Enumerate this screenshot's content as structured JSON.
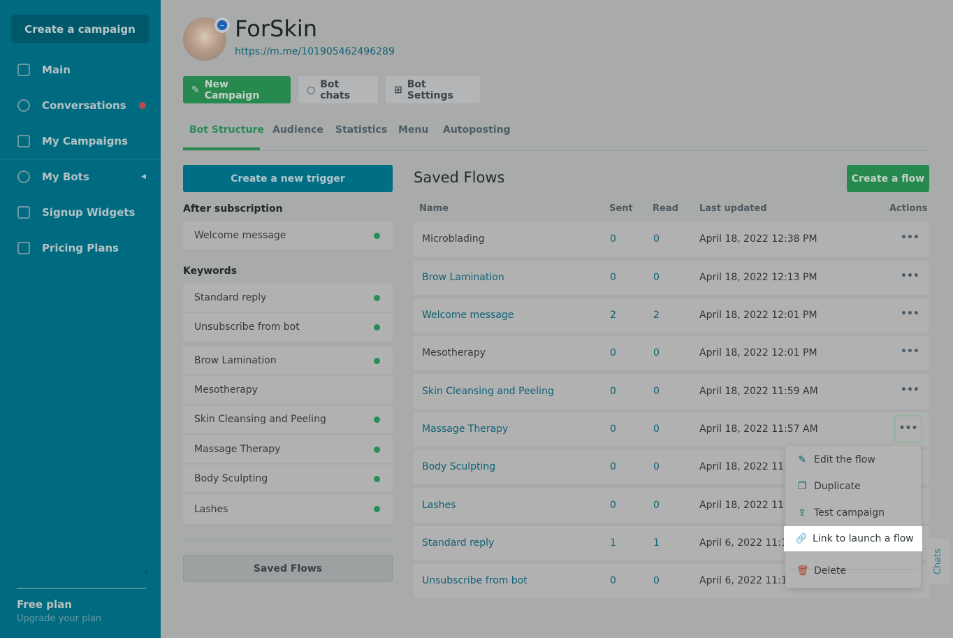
{
  "sidebar": {
    "create_label": "Create a campaign",
    "items": [
      {
        "label": "Main",
        "icon": "sliders-icon"
      },
      {
        "label": "Conversations",
        "icon": "chat-icon",
        "badge": "red-dot"
      },
      {
        "label": "My Campaigns",
        "icon": "upload-icon"
      },
      {
        "label": "My Bots",
        "icon": "globe-icon"
      },
      {
        "label": "Signup Widgets",
        "icon": "widget-icon"
      },
      {
        "label": "Pricing Plans",
        "icon": "wallet-icon"
      }
    ],
    "plan_title": "Free plan",
    "plan_sub": "Upgrade your plan"
  },
  "header": {
    "title": "ForSkin",
    "url": "https://m.me/101905462496289",
    "buttons": {
      "new_campaign": "New Campaign",
      "bot_chats": "Bot chats",
      "bot_settings": "Bot Settings"
    }
  },
  "tabs": [
    "Bot Structure",
    "Audience",
    "Statistics",
    "Menu",
    "Autoposting"
  ],
  "left": {
    "trigger_label": "Create a new trigger",
    "after_sub_label": "After subscription",
    "after_sub": [
      {
        "label": "Welcome message",
        "active": true
      }
    ],
    "keywords_label": "Keywords",
    "keywords": [
      {
        "label": "Standard reply",
        "active": true
      },
      {
        "label": "Unsubscribe from bot",
        "active": true
      }
    ],
    "flows": [
      {
        "label": "Brow Lamination",
        "active": true
      },
      {
        "label": "Mesotherapy",
        "active": false
      },
      {
        "label": "Skin Cleansing and Peeling",
        "active": true
      },
      {
        "label": "Massage Therapy",
        "active": true
      },
      {
        "label": "Body Sculpting",
        "active": true
      },
      {
        "label": "Lashes",
        "active": true
      }
    ],
    "saved_flows_label": "Saved Flows"
  },
  "saved": {
    "title": "Saved Flows",
    "create_label": "Create a flow",
    "columns": [
      "Name",
      "Sent",
      "Read",
      "Last updated",
      "Actions"
    ],
    "rows": [
      {
        "name": "Microblading",
        "link": false,
        "sent": "0",
        "read": "0",
        "date": "April 18, 2022 12:38 PM"
      },
      {
        "name": "Brow Lamination",
        "link": true,
        "sent": "0",
        "read": "0",
        "date": "April 18, 2022 12:13 PM"
      },
      {
        "name": "Welcome message",
        "link": true,
        "sent": "2",
        "read": "2",
        "date": "April 18, 2022 12:01 PM"
      },
      {
        "name": "Mesotherapy",
        "link": false,
        "sent": "0",
        "read": "0",
        "date": "April 18, 2022 12:01 PM"
      },
      {
        "name": "Skin Cleansing and Peeling",
        "link": true,
        "sent": "0",
        "read": "0",
        "date": "April 18, 2022 11:59 AM"
      },
      {
        "name": "Massage Therapy",
        "link": true,
        "sent": "0",
        "read": "0",
        "date": "April 18, 2022 11:57 AM"
      },
      {
        "name": "Body Sculpting",
        "link": true,
        "sent": "0",
        "read": "0",
        "date": "April 18, 2022 11:"
      },
      {
        "name": "Lashes",
        "link": true,
        "sent": "0",
        "read": "0",
        "date": "April 18, 2022 11:"
      },
      {
        "name": "Standard reply",
        "link": true,
        "sent": "1",
        "read": "1",
        "date": "April 6, 2022 11:1"
      },
      {
        "name": "Unsubscribe from bot",
        "link": true,
        "sent": "0",
        "read": "0",
        "date": "April 6, 2022 11:1"
      }
    ]
  },
  "menu": {
    "edit": "Edit the flow",
    "duplicate": "Duplicate",
    "test": "Test campaign",
    "link": "Link to launch a flow",
    "delete": "Delete"
  },
  "chats_tab": "Chats"
}
